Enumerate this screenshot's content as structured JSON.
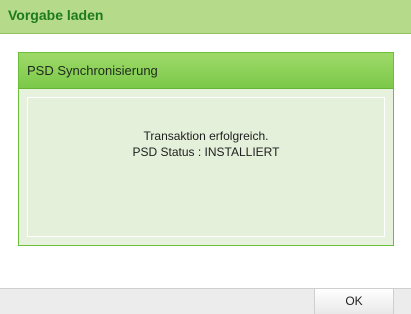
{
  "window": {
    "title": "Vorgabe laden"
  },
  "dialog": {
    "title": "PSD Synchronisierung",
    "message_line1": "Transaktion erfolgreich.",
    "message_line2": "PSD Status : INSTALLIERT"
  },
  "footer": {
    "ok_label": "OK"
  },
  "colors": {
    "title_bar": "#b4da8a",
    "title_text": "#1d7a1d",
    "dialog_header": "#7cc94a",
    "dialog_body": "#e4f0da",
    "dialog_border": "#6cbf3a"
  }
}
